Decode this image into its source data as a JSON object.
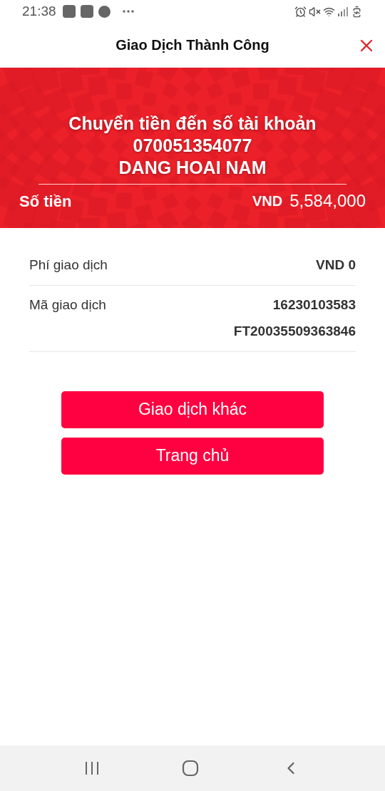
{
  "status_bar": {
    "time": "21:38"
  },
  "header": {
    "title": "Giao Dịch Thành Công"
  },
  "banner": {
    "lines": [
      "Chuyển tiền đến số tài khoản",
      "070051354077",
      "DANG HOAI NAM"
    ],
    "amount_label": "Số tiền",
    "currency": "VND",
    "amount": "5,584,000"
  },
  "details": [
    {
      "label": "Phí giao dịch",
      "value_lines": [
        "VND 0"
      ]
    },
    {
      "label": "Mã giao dịch",
      "value_lines": [
        "16230103583",
        "FT20035509363846"
      ]
    }
  ],
  "buttons": [
    "Giao dịch khác",
    "Trang chủ"
  ]
}
